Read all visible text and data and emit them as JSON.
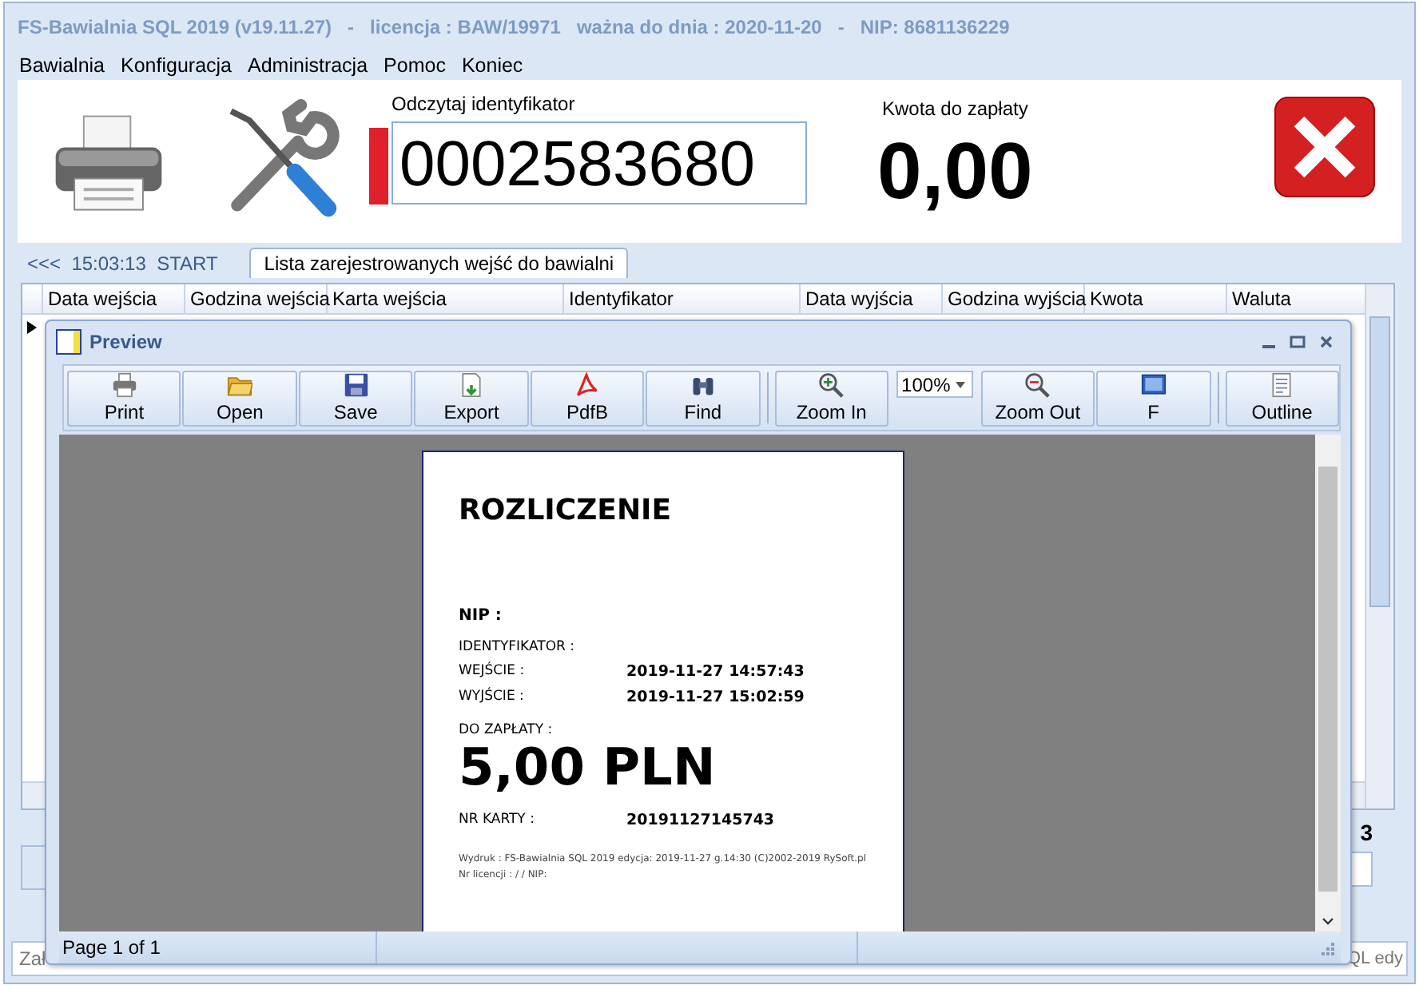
{
  "window": {
    "title": "FS-Bawialnia SQL 2019 (v19.11.27)   -   licencja : BAW/19971   ważna do dnia : 2020-11-20   -   NIP: 8681136229"
  },
  "menu": [
    "Bawialnia",
    "Konfiguracja",
    "Administracja",
    "Pomoc",
    "Koniec"
  ],
  "header": {
    "id_label": "Odczytaj identyfikator",
    "id_value": "0002583680",
    "amount_label": "Kwota do zapłaty",
    "amount": "0,00"
  },
  "tabs": [
    {
      "label": "<<<  15:03:13  START",
      "selected": false
    },
    {
      "label": "Lista zarejestrowanych wejść do bawialni",
      "selected": true
    }
  ],
  "table": {
    "columns": [
      "Data wejścia",
      "Godzina wejścia",
      "Karta wejścia",
      "Identyfikator",
      "Data wyjścia",
      "Godzina wyjścia",
      "Kwota",
      "Waluta"
    ]
  },
  "side_value": "3",
  "status_bar": {
    "left": "Zał",
    "right": "QL edy"
  },
  "preview": {
    "title": "Preview",
    "toolbar": [
      {
        "kind": "print",
        "label": "Print"
      },
      {
        "kind": "open",
        "label": "Open"
      },
      {
        "kind": "save",
        "label": "Save"
      },
      {
        "kind": "export",
        "label": "Export"
      },
      {
        "kind": "pdf",
        "label": "PdfB"
      },
      {
        "kind": "find",
        "label": "Find"
      },
      {
        "kind": "separator"
      },
      {
        "kind": "zoomin",
        "label": "Zoom In"
      },
      {
        "kind": "combo",
        "label": "100%"
      },
      {
        "kind": "zoomout",
        "label": "Zoom Out"
      },
      {
        "kind": "monitor",
        "label": "F"
      },
      {
        "kind": "separator"
      },
      {
        "kind": "outline",
        "label": "Outline"
      }
    ],
    "report": {
      "title": "ROZLICZENIE",
      "nip_label": "NIP :",
      "id_label": "IDENTYFIKATOR :",
      "rows": [
        {
          "label": "WEJŚCIE :",
          "value": "2019-11-27 14:57:43"
        },
        {
          "label": "WYJŚCIE :",
          "value": "2019-11-27 15:02:59"
        }
      ],
      "due_label": "DO ZAPŁATY :",
      "amount": "5,00 PLN",
      "card_label": "NR KARTY :",
      "card_value": "20191127145743",
      "footer": [
        "Wydruk : FS-Bawialnia SQL 2019  edycja: 2019-11-27  g.14:30  (C)2002-2019 RySoft.pl",
        "Nr licencji : /   /   NIP:"
      ]
    },
    "status": "Page 1 of 1"
  }
}
